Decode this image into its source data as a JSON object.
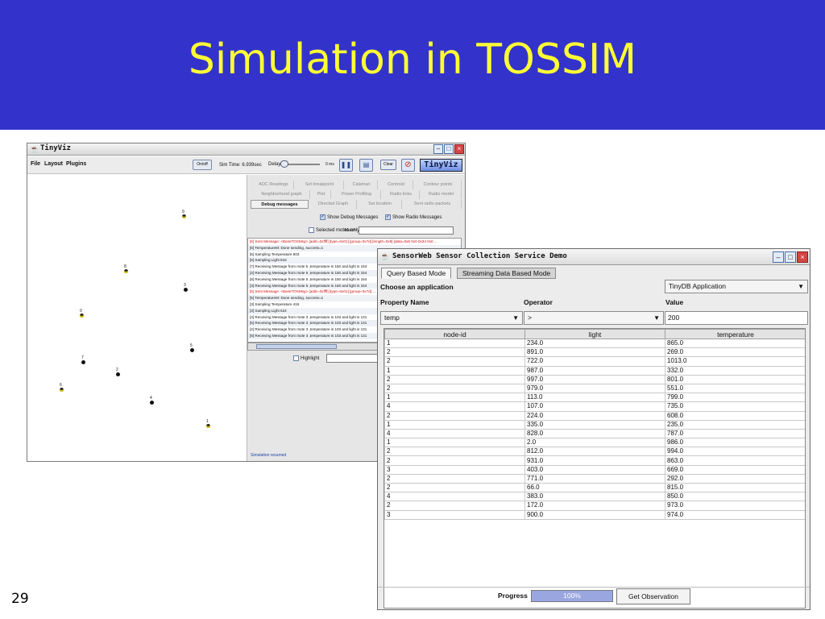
{
  "slide": {
    "title": "Simulation in TOSSIM",
    "number": "29",
    "header_color": "#3333cc",
    "title_color": "#ffff33"
  },
  "tinyviz": {
    "window_title": "TinyViz",
    "menu": [
      "File",
      "Layout",
      "Plugins"
    ],
    "onoff_label": "On/off",
    "sim_time": "Sim Time: 6.939sec",
    "delay_label": "Delay",
    "delay_value": "0 ms",
    "clear_label": "Clear",
    "logo": "TinyViz",
    "icons": [
      "pause-icon",
      "grid-icon",
      "stop-icon"
    ],
    "plugins_row1": [
      "ADC Readings",
      "Set breakpoint",
      "Calamari",
      "Centroid",
      "Contour points"
    ],
    "plugins_row2": [
      "Neighborhood graph",
      "Plot",
      "Power Profiling",
      "Radio links",
      "Radio model"
    ],
    "plugins_row3": [
      "Debug messages",
      "Directed Graph",
      "Set location",
      "Sent radio packets"
    ],
    "show_debug": "Show Debug Messages",
    "show_radio": "Show Radio Messages",
    "selected_motes": "Selected motes only",
    "match_label": "Match:",
    "log": [
      {
        "text": "[6] Sent Message: <BaseTOSMsg>   [addr=0xffff]   [type=0x01]   [group=0x7d]   [length=0x8]   [data=0x8 0x0 0x34 0x0 ...",
        "red": true
      },
      {
        "text": "[6] TemperatureM: Done sending, success=1",
        "red": false
      },
      {
        "text": "[6] Sampling Temperature 803",
        "red": false
      },
      {
        "text": "[6] Sampling Light 816",
        "red": false
      },
      {
        "text": "[7] Receiving Message from mote 5 ,temperature is 150 and light is 154",
        "red": false
      },
      {
        "text": "[4] Receiving Message from mote 5 ,temperature is 150 and light is 154",
        "red": false
      },
      {
        "text": "[8] Receiving Message from mote 5 ,temperature is 150 and light is 154",
        "red": false
      },
      {
        "text": "[3] Receiving Message from mote 5 ,temperature is 150 and light is 154",
        "red": false
      },
      {
        "text": "[5] Sent Message: <BaseTOSMsg>   [addr=0xffff]   [type=0x01]   [group=0x7d] ...",
        "red": true
      },
      {
        "text": "[5] TemperatureM: Done sending, success=1",
        "red": false
      },
      {
        "text": "[3] Sampling Temperature 415",
        "red": false
      },
      {
        "text": "[3] Sampling Light 524",
        "red": false
      },
      {
        "text": "[4] Receiving Message from mote 3 ,temperature is 103 and light is 131",
        "red": false
      },
      {
        "text": "[5] Receiving Message from mote 3 ,temperature is 103 and light is 131",
        "red": false
      },
      {
        "text": "[2] Receiving Message from mote 3 ,temperature is 103 and light is 131",
        "red": false
      },
      {
        "text": "[6] Receiving Message from mote 3 ,temperature is 103 and light is 131",
        "red": false
      }
    ],
    "highlight_label": "Highlight",
    "status": "Simulation resumed",
    "motes": [
      {
        "label": "9",
        "yellow": true
      },
      {
        "label": "8",
        "yellow": true
      },
      {
        "label": "3",
        "yellow": false
      },
      {
        "label": "0",
        "yellow": true
      },
      {
        "label": "5",
        "yellow": false
      },
      {
        "label": "7",
        "yellow": false
      },
      {
        "label": "2",
        "yellow": false
      },
      {
        "label": "6",
        "yellow": true
      },
      {
        "label": "4",
        "yellow": false
      },
      {
        "label": "1",
        "yellow": true
      }
    ]
  },
  "sensorweb": {
    "window_title": "SensorWeb Sensor Collection Service Demo",
    "tabs": [
      "Query Based Mode",
      "Streaming Data Based Mode"
    ],
    "choose_app_label": "Choose an application",
    "app_selected": "TinyDB Application",
    "property_label": "Property Name",
    "operator_label": "Operator",
    "value_label": "Value",
    "property_selected": "temp",
    "operator_selected": ">",
    "value": "200",
    "columns": [
      "node-id",
      "light",
      "temperature"
    ],
    "rows": [
      [
        "1",
        "234.0",
        "865.0"
      ],
      [
        "2",
        "891.0",
        "269.0"
      ],
      [
        "2",
        "722.0",
        "1013.0"
      ],
      [
        "1",
        "987.0",
        "332.0"
      ],
      [
        "2",
        "997.0",
        "801.0"
      ],
      [
        "2",
        "979.0",
        "551.0"
      ],
      [
        "1",
        "113.0",
        "799.0"
      ],
      [
        "4",
        "107.0",
        "735.0"
      ],
      [
        "2",
        "224.0",
        "608.0"
      ],
      [
        "1",
        "335.0",
        "235.0"
      ],
      [
        "4",
        "828.0",
        "787.0"
      ],
      [
        "1",
        "2.0",
        "986.0"
      ],
      [
        "2",
        "812.0",
        "994.0"
      ],
      [
        "2",
        "931.0",
        "863.0"
      ],
      [
        "3",
        "403.0",
        "669.0"
      ],
      [
        "2",
        "771.0",
        "292.0"
      ],
      [
        "2",
        "66.0",
        "815.0"
      ],
      [
        "4",
        "383.0",
        "850.0"
      ],
      [
        "2",
        "172.0",
        "973.0"
      ],
      [
        "3",
        "900.0",
        "974.0"
      ]
    ],
    "progress_label": "Progress",
    "progress_text": "100%",
    "progress_value": 1.0,
    "get_observation": "Get Observation"
  }
}
